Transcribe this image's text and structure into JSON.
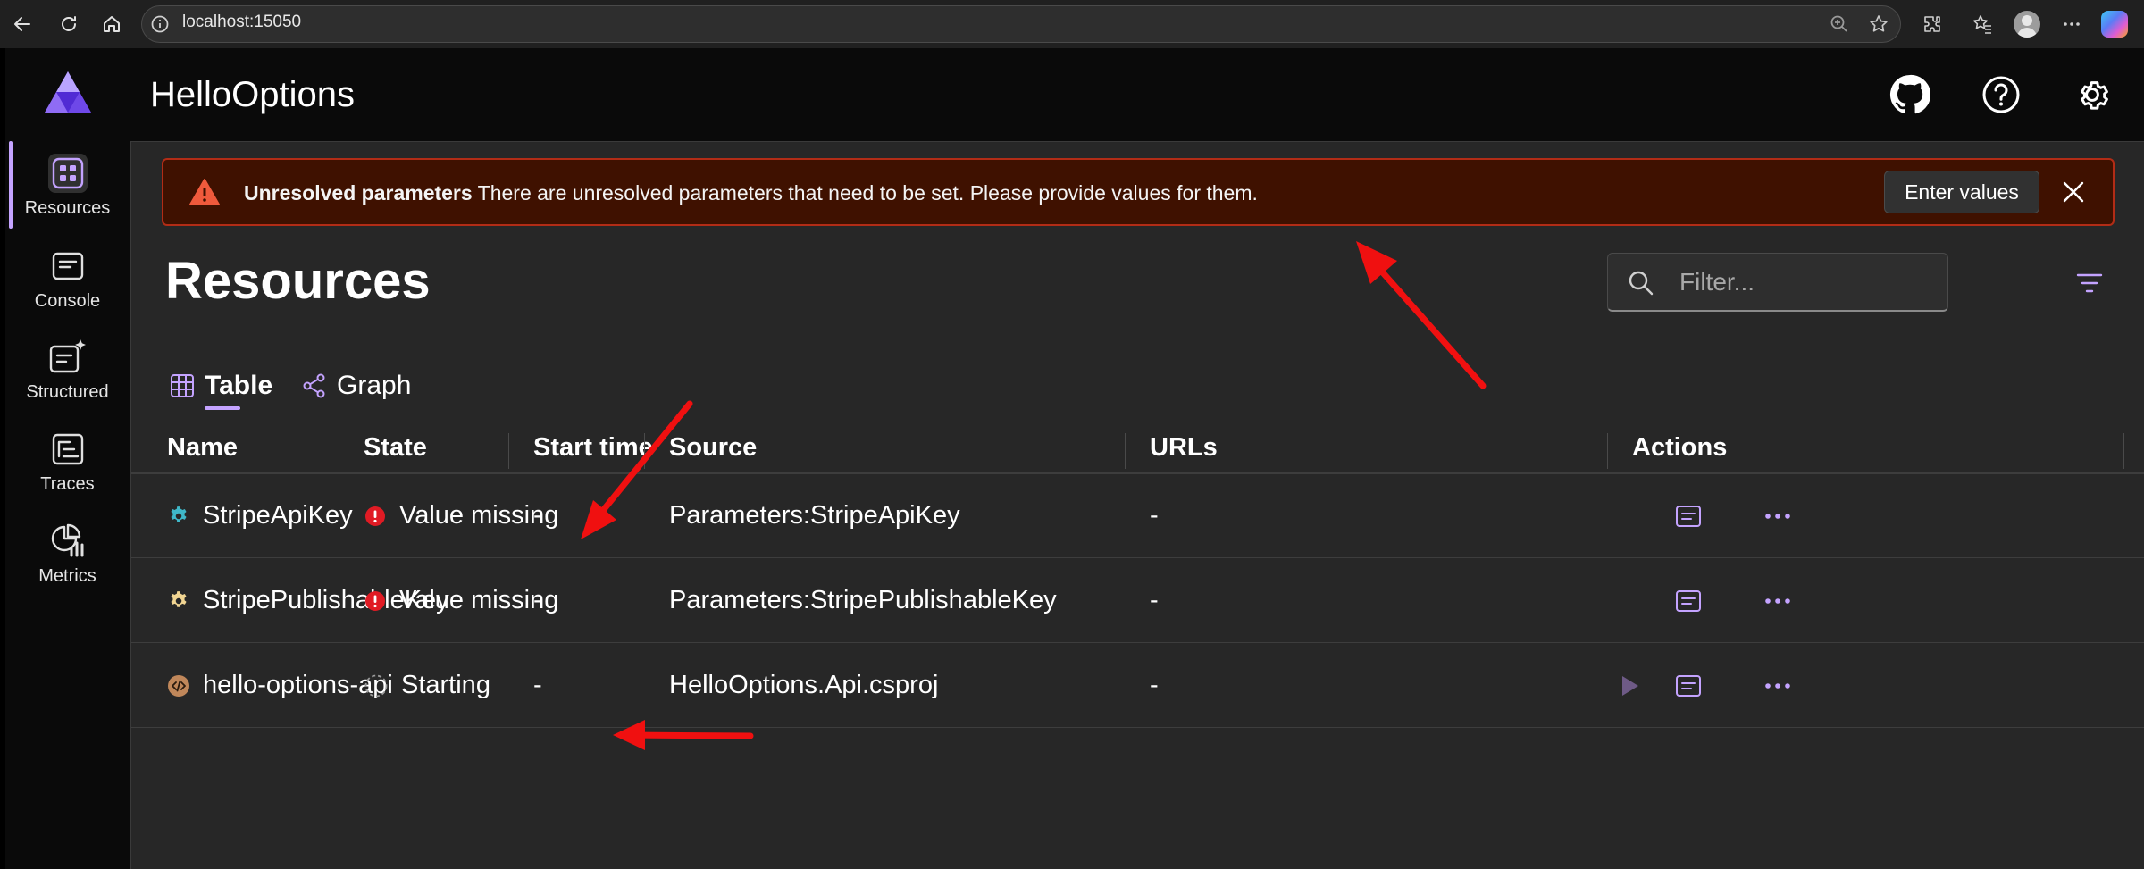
{
  "browser": {
    "url": "localhost:15050"
  },
  "app": {
    "title": "HelloOptions",
    "nav": [
      {
        "label": "Resources",
        "icon": "resources-icon",
        "active": true
      },
      {
        "label": "Console",
        "icon": "console-icon"
      },
      {
        "label": "Structured",
        "icon": "structured-logs-icon"
      },
      {
        "label": "Traces",
        "icon": "traces-icon"
      },
      {
        "label": "Metrics",
        "icon": "metrics-icon"
      }
    ]
  },
  "banner": {
    "title": "Unresolved parameters",
    "message": "There are unresolved parameters that need to be set. Please provide values for them.",
    "button_label": "Enter values"
  },
  "page": {
    "title": "Resources",
    "filter_placeholder": "Filter...",
    "tabs": [
      {
        "label": "Table",
        "active": true
      },
      {
        "label": "Graph"
      }
    ]
  },
  "table": {
    "columns": [
      "Name",
      "State",
      "Start time",
      "Source",
      "URLs",
      "Actions"
    ],
    "rows": [
      {
        "name": "StripeApiKey",
        "icon": "gear-icon",
        "state": "Value missing",
        "state_icon": "error-icon",
        "start_time": "-",
        "source": "Parameters:StripeApiKey",
        "urls": "-"
      },
      {
        "name": "StripePublishableKey",
        "icon": "gear-icon",
        "state": "Value missing",
        "state_icon": "error-icon",
        "start_time": "-",
        "source": "Parameters:StripePublishableKey",
        "urls": "-"
      },
      {
        "name": "hello-options-api",
        "icon": "project-icon",
        "state": "Starting",
        "state_icon": "spinner-icon",
        "start_time": "-",
        "source": "HelloOptions.Api.csproj",
        "urls": "-"
      }
    ]
  },
  "colors": {
    "accent": "#c4a3ff",
    "banner_bg": "#3f1100",
    "banner_border": "#b22c16",
    "error": "#e01b24",
    "param_icon_teal": "#3fb8c9",
    "param_icon_yellow": "#f1d592",
    "project_icon": "#c0875a"
  }
}
